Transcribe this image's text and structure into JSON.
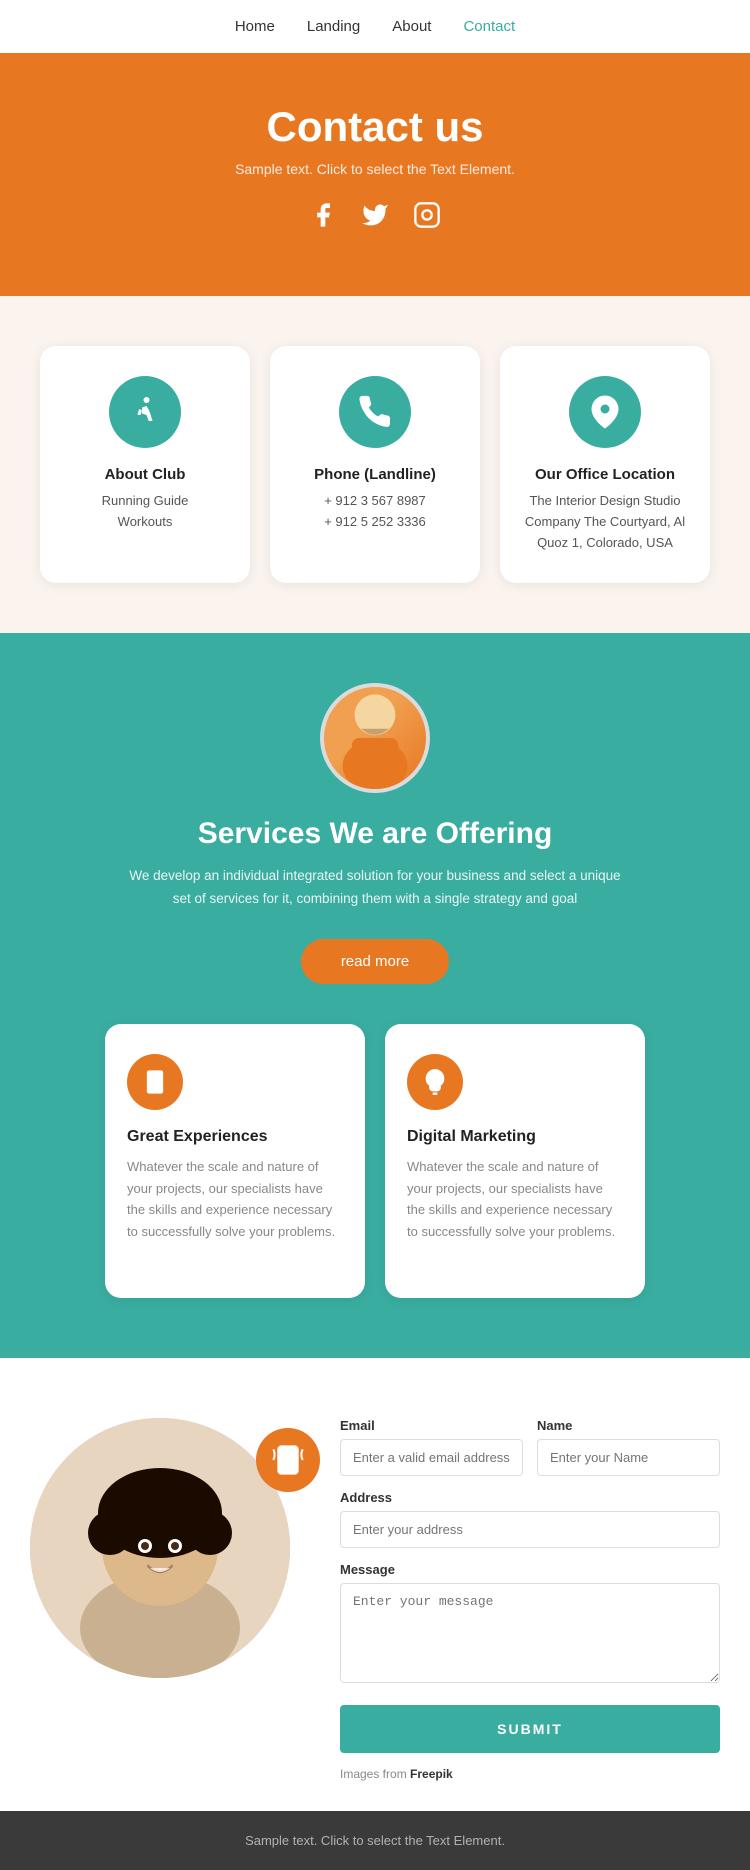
{
  "nav": {
    "items": [
      {
        "label": "Home",
        "active": false
      },
      {
        "label": "Landing",
        "active": false
      },
      {
        "label": "About",
        "active": false
      },
      {
        "label": "Contact",
        "active": true
      }
    ]
  },
  "hero": {
    "title": "Contact us",
    "subtitle": "Sample text. Click to select the Text Element.",
    "social": [
      "facebook",
      "twitter",
      "instagram"
    ]
  },
  "cards": [
    {
      "icon": "runner",
      "title": "About Club",
      "lines": [
        "Running Guide",
        "Workouts"
      ]
    },
    {
      "icon": "phone",
      "title": "Phone (Landline)",
      "lines": [
        "+ 912 3 567 8987",
        "+ 912 5 252 3336"
      ]
    },
    {
      "icon": "location",
      "title": "Our Office Location",
      "lines": [
        "The Interior Design Studio Company The Courtyard, Al Quoz 1, Colorado, USA"
      ]
    }
  ],
  "services": {
    "title": "Services We are Offering",
    "description": "We develop an individual integrated solution for your business and select a unique set of services for it, combining them with a single strategy and goal",
    "read_more_btn": "read more",
    "cards": [
      {
        "icon": "mobile",
        "title": "Great Experiences",
        "description": "Whatever the scale and nature of your projects, our specialists have the skills and experience necessary to successfully solve your problems."
      },
      {
        "icon": "bulb",
        "title": "Digital Marketing",
        "description": "Whatever the scale and nature of your projects, our specialists have the skills and experience necessary to successfully solve your problems."
      }
    ]
  },
  "contact_form": {
    "fields": {
      "email_label": "Email",
      "email_placeholder": "Enter a valid email address",
      "name_label": "Name",
      "name_placeholder": "Enter your Name",
      "address_label": "Address",
      "address_placeholder": "Enter your address",
      "message_label": "Message",
      "message_placeholder": "Enter your message"
    },
    "submit_label": "SUBMIT",
    "freepik_note": "Images from",
    "freepik_brand": "Freepik"
  },
  "footer": {
    "text": "Sample text. Click to select the Text Element."
  }
}
